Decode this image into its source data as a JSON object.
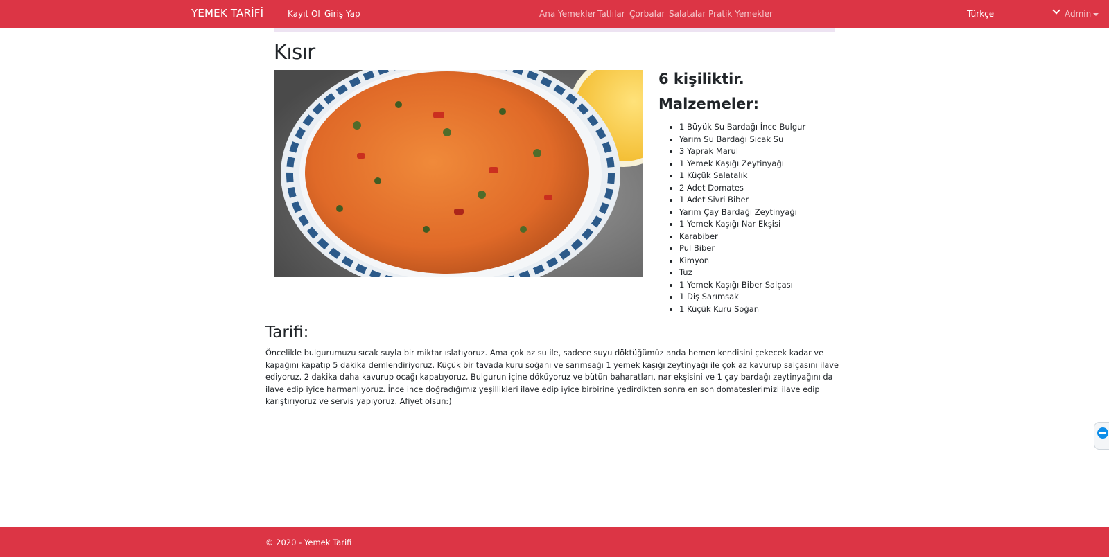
{
  "navbar": {
    "brand": "YEMEK TARİFİ",
    "auth_links": [
      "Kayıt Ol",
      "Giriş Yap"
    ],
    "categories": [
      "Ana Yemekler",
      "Tatlılar",
      "Çorbalar",
      "Salatalar",
      "Pratik Yemekler"
    ],
    "language_select": {
      "value": "Türkçe",
      "icon": "chevron-down-icon"
    },
    "admin_menu": {
      "label": "Admin",
      "icon": "caret-down-icon"
    }
  },
  "recipe": {
    "title": "Kısır",
    "image_alt": "Kısır",
    "serving": "6 kişiliktir.",
    "ingredients_title": "Malzemeler:",
    "ingredients": [
      "1 Büyük Su Bardağı İnce Bulgur",
      "Yarım Su Bardağı Sıcak Su",
      "3 Yaprak Marul",
      "1 Yemek Kaşığı Zeytinyağı",
      "1 Küçük Salatalık",
      "2 Adet Domates",
      "1 Adet Sivri Biber",
      "Yarım Çay Bardağı Zeytinyağı",
      "1 Yemek Kaşığı Nar Ekşisi",
      "Karabiber",
      "Pul Biber",
      "Kimyon",
      "Tuz",
      "1 Yemek Kaşığı Biber Salçası",
      "1 Diş Sarımsak",
      "1 Küçük Kuru Soğan"
    ],
    "instructions_title": "Tarifi:",
    "instructions": "Öncelikle bulgurumuzu sıcak suyla bir miktar ıslatıyoruz. Ama çok az su ile, sadece suyu döktüğümüz anda hemen kendisini çekecek kadar ve kapağını kapatıp 5 dakika demlendiriyoruz. Küçük bir tavada kuru soğanı ve sarımsağı 1 yemek kaşığı zeytinyağı ile çok az kavurup salçasını ilave ediyoruz. 2 dakika daha kavurup ocağı kapatıyoruz. Bulgurun içine döküyoruz ve bütün baharatları, nar ekşisini ve 1 çay bardağı zeytinyağını da ilave edip iyice harmanlıyoruz. İnce ince doğradığımız yeşillikleri ilave edip iyice birbirine yedirdikten sonra en son domateslerimizi ilave edip karıştırıyoruz ve servis yapıyoruz. Afiyet olsun:)"
  },
  "footer": {
    "copyright": "© 2020 - Yemek Tarifi"
  },
  "side_widget": {
    "icon": "remote-support-icon"
  },
  "colors": {
    "brand": "#dc3545",
    "text": "#212529",
    "strip": "#ede3f2"
  }
}
